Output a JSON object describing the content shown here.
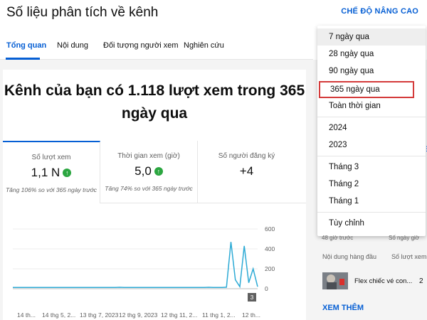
{
  "header": {
    "title": "Số liệu phân tích về kênh",
    "advanced_mode": "CHẾ ĐỘ NÂNG CAO"
  },
  "tabs": [
    {
      "label": "Tổng quan",
      "active": true
    },
    {
      "label": "Nội dung",
      "active": false
    },
    {
      "label": "Đối tượng người xem",
      "active": false
    },
    {
      "label": "Nghiên cứu",
      "active": false
    }
  ],
  "headline": "Kênh của bạn có 1.118 lượt xem trong 365 ngày qua",
  "metrics": [
    {
      "label": "Số lượt xem",
      "value": "1,1 N",
      "note": "Tăng 106% so với 365 ngày trước",
      "trend": "up"
    },
    {
      "label": "Thời gian xem (giờ)",
      "value": "5,0",
      "note": "Tăng 74% so với 365 ngày trước",
      "trend": "up"
    },
    {
      "label": "Số người đăng ký",
      "value": "+4",
      "note": ""
    }
  ],
  "chart_data": {
    "type": "line",
    "x_tick_labels": [
      "14 th...",
      "14 thg 5, 2...",
      "13 thg 7, 2023",
      "12 thg 9, 2023",
      "12 thg 11, 2...",
      "11 thg 1, 2...",
      "12 th..."
    ],
    "y_ticks": [
      0,
      200,
      400,
      600
    ],
    "ylim": [
      0,
      600
    ],
    "series": [
      {
        "values": [
          12,
          12,
          12,
          12,
          12,
          12,
          12,
          12,
          12,
          12,
          12,
          12,
          12,
          12,
          12,
          12,
          12,
          12,
          12,
          12,
          12,
          12,
          12,
          12,
          14,
          12,
          12,
          12,
          12,
          12,
          12,
          12,
          12,
          12,
          12,
          12,
          12,
          12,
          12,
          12,
          12,
          12,
          12,
          12,
          14,
          12,
          12,
          12,
          15,
          470,
          90,
          20,
          430,
          60,
          200,
          20
        ]
      }
    ],
    "marker_label": "3",
    "color": "#2caad5"
  },
  "menu": {
    "items": [
      {
        "label": "7 ngày qua",
        "highlighted": true
      },
      {
        "label": "28 ngày qua"
      },
      {
        "label": "90 ngày qua"
      },
      {
        "label": "365 ngày qua",
        "selected": true
      },
      {
        "label": "Toàn thời gian"
      },
      {
        "label": "2024"
      },
      {
        "label": "2023"
      },
      {
        "label": "Tháng 3"
      },
      {
        "label": "Tháng 2"
      },
      {
        "label": "Tháng 1"
      },
      {
        "label": "Tùy chỉnh"
      }
    ]
  },
  "right_panel": {
    "partial_left": "48 giờ trước",
    "partial_right": "Số ngày giờ",
    "top_content_label": "Nội dung hàng đầu",
    "views_label": "Số lượt xem",
    "row_title": "Flex chiếc vé con...",
    "row_value": "2",
    "see_more": "XEM THÊM"
  }
}
